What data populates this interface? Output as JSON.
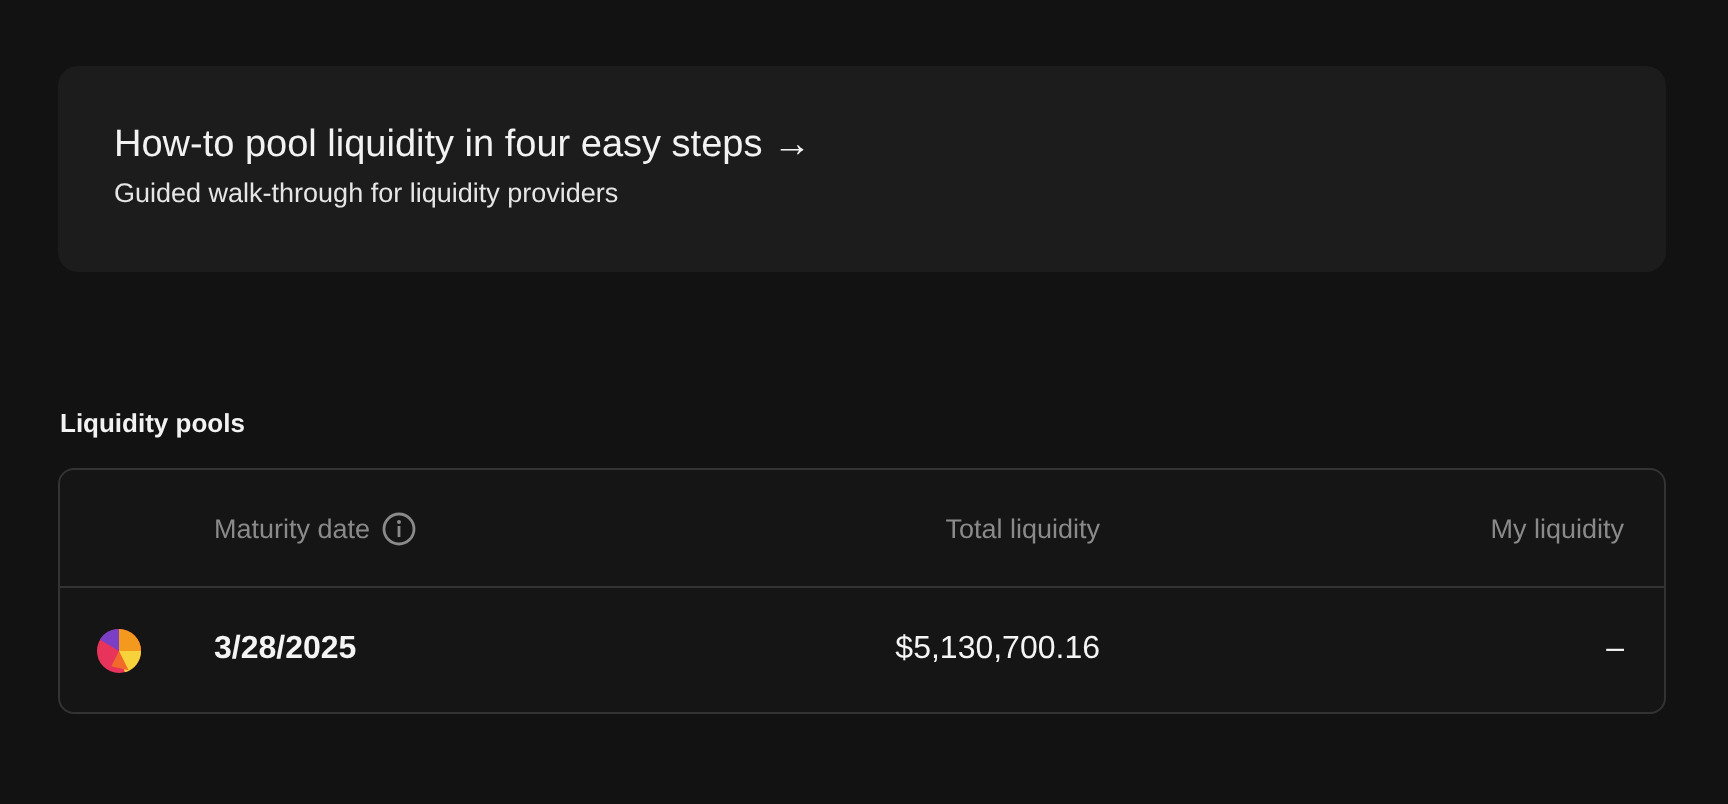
{
  "guide_card": {
    "title": "How-to pool liquidity in four easy steps →",
    "subtitle": "Guided walk-through for liquidity providers"
  },
  "section_title": "Liquidity pools",
  "table": {
    "columns": [
      {
        "label": "Maturity date",
        "info": true
      },
      {
        "label": "Total liquidity",
        "info": false
      },
      {
        "label": "My liquidity",
        "info": false
      }
    ],
    "rows": [
      {
        "maturity_date": "3/28/2025",
        "total_liquidity": "$5,130,700.16",
        "my_liquidity": "–"
      }
    ]
  }
}
